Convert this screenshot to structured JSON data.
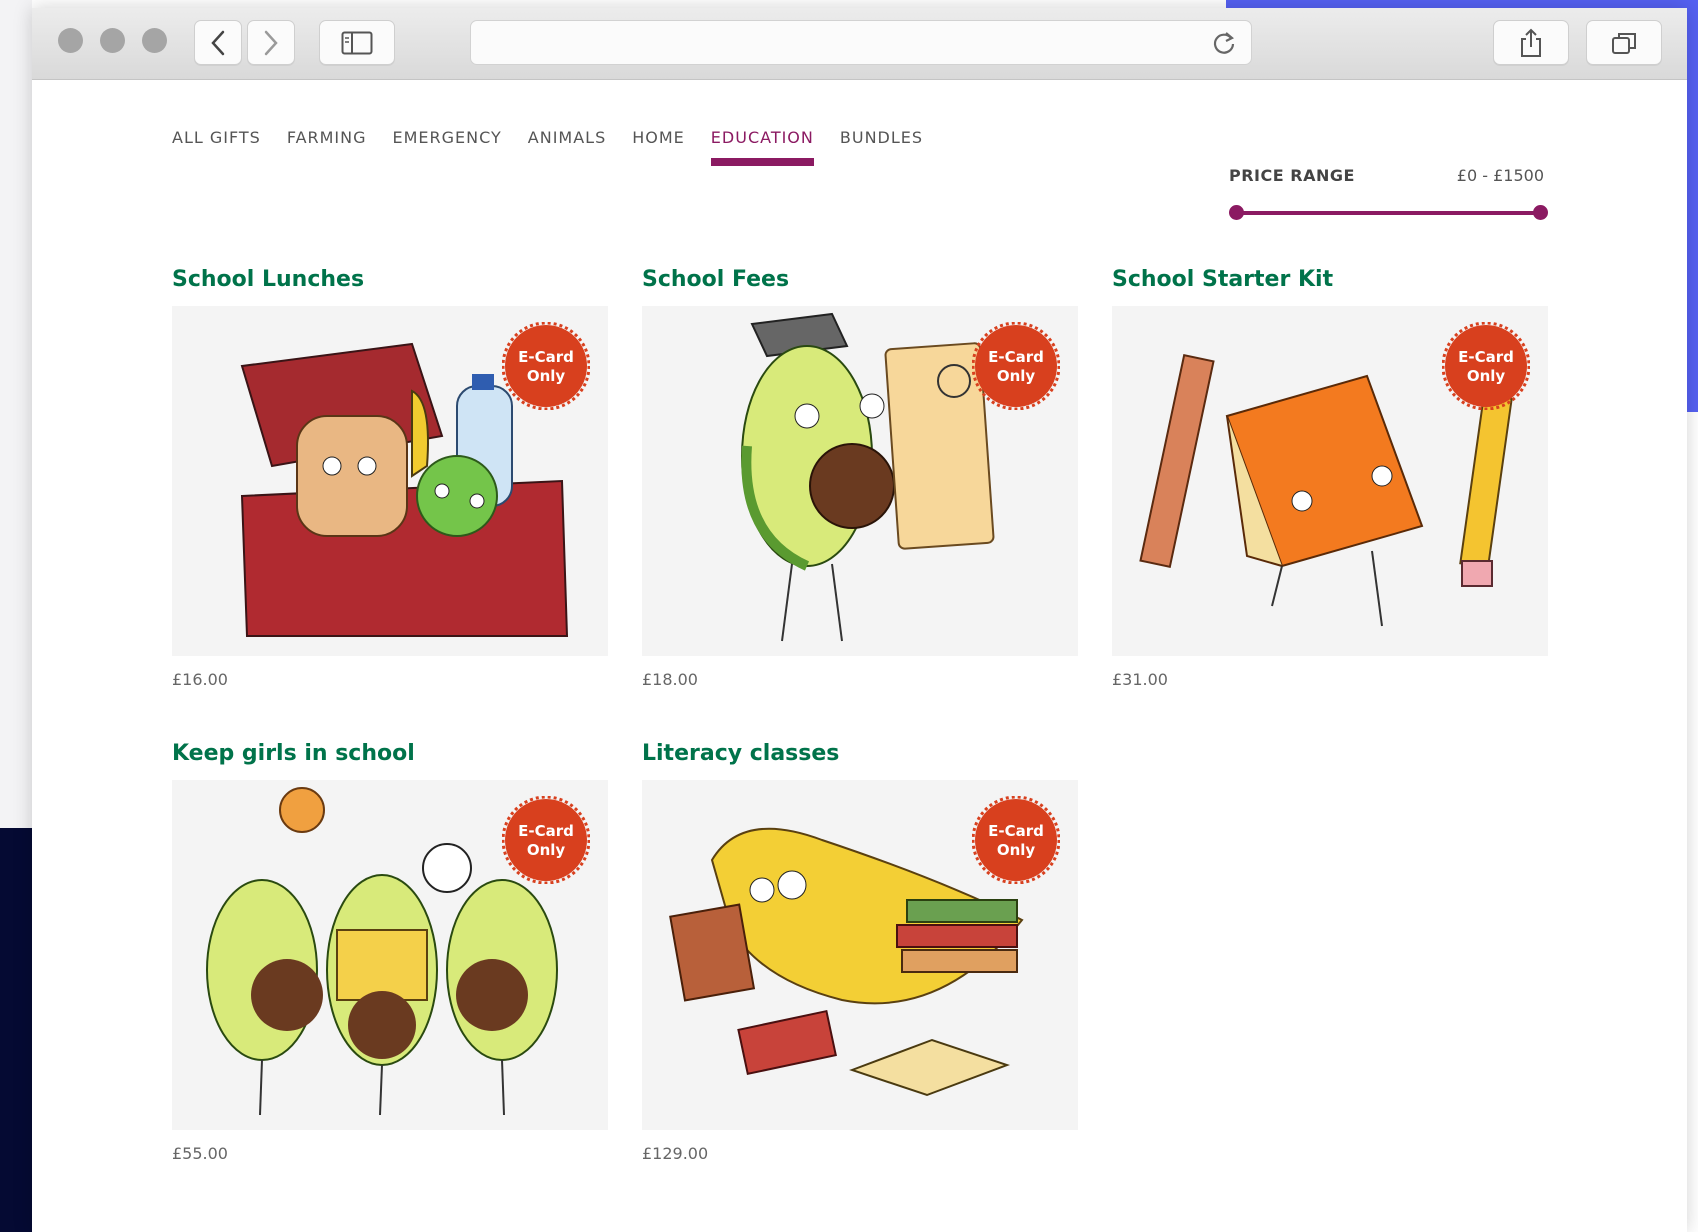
{
  "colors": {
    "accent": "#8b1a62",
    "title_green": "#00734a",
    "badge_red": "#d8401e",
    "navy": "#050a33",
    "blue": "#5561f2"
  },
  "browser": {
    "url": "",
    "icons": [
      "back-icon",
      "forward-icon",
      "sidebar-icon",
      "reload-icon",
      "share-icon",
      "tabs-icon"
    ]
  },
  "nav": {
    "items": [
      {
        "label": "ALL GIFTS",
        "active": false
      },
      {
        "label": "FARMING",
        "active": false
      },
      {
        "label": "EMERGENCY",
        "active": false
      },
      {
        "label": "ANIMALS",
        "active": false
      },
      {
        "label": "HOME",
        "active": false
      },
      {
        "label": "EDUCATION",
        "active": true
      },
      {
        "label": "BUNDLES",
        "active": false
      }
    ]
  },
  "price_range": {
    "label": "PRICE RANGE",
    "value_text": "£0 - £1500",
    "min": 0,
    "max": 1500
  },
  "products": [
    {
      "title": "School Lunches",
      "price": "£16.00",
      "badge_line1": "E-Card",
      "badge_line2": "Only",
      "illustration": "lunchbox-illustration"
    },
    {
      "title": "School Fees",
      "price": "£18.00",
      "badge_line1": "E-Card",
      "badge_line2": "Only",
      "illustration": "avocado-graduate-illustration"
    },
    {
      "title": "School Starter Kit",
      "price": "£31.00",
      "badge_line1": "E-Card",
      "badge_line2": "Only",
      "illustration": "notebook-ruler-pencil-illustration"
    },
    {
      "title": "Keep girls in school",
      "price": "£55.00",
      "badge_line1": "E-Card",
      "badge_line2": "Only",
      "illustration": "avocados-playing-illustration"
    },
    {
      "title": "Literacy classes",
      "price": "£129.00",
      "badge_line1": "E-Card",
      "badge_line2": "Only",
      "illustration": "banana-reading-illustration"
    }
  ]
}
